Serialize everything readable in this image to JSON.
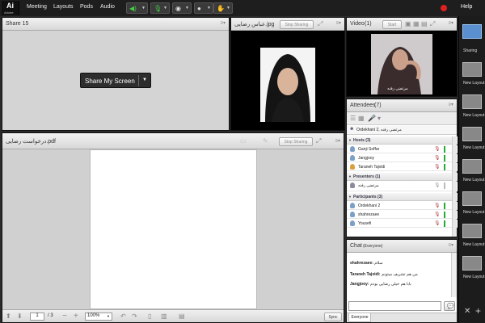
{
  "topbar": {
    "logo_mark": "Ai",
    "logo_text": "Adobe",
    "menus": [
      "Meeting",
      "Layouts",
      "Pods",
      "Audio"
    ],
    "help": "Help",
    "colors": {
      "bg": "#1e1e1e",
      "record": "#e02020"
    },
    "icons": [
      "microphone-icon",
      "webcam-icon",
      "user-icon",
      "raise-hand-icon"
    ]
  },
  "share_pod": {
    "title": "Share 15",
    "button_label": "Share My Screen"
  },
  "image_pod": {
    "title": "عباس رضایی.jpg",
    "stop_sharing": "Stop Sharing"
  },
  "video_pod": {
    "title": "Video",
    "count": "(1)",
    "start_label": "Start",
    "caption": "مرتضی رفنه"
  },
  "attendees_pod": {
    "title": "Attendees",
    "count": "(7)",
    "current_user": "Ordekhani 2, مرتضی رفنه",
    "hosts_header": "Hosts (3)",
    "hosts": [
      "Ganji Soffar",
      "Jangjooy",
      "Taraneh Tajvidi"
    ],
    "presenters_header": "Presenters (1)",
    "presenters": [
      "مرتضی رفنه"
    ],
    "participants_header": "Participants (3)",
    "participants": [
      "Ordekhani 2",
      "shahrezaee",
      "Yousefi"
    ]
  },
  "pdf_pod": {
    "title": "درخواست رضایی.pdf",
    "stop_sharing": "Stop Sharing",
    "page_current": "1",
    "page_total": "/ 3",
    "zoom": "100%",
    "sync_label": "Sync"
  },
  "chat_pod": {
    "title": "Chat",
    "audience": "(Everyone)",
    "messages": [
      {
        "from": "shahrezaee:",
        "text": "سلام"
      },
      {
        "from": "Taraneh Tajvidi:",
        "text": "من هم تشریف میتونم"
      },
      {
        "from": "Jangjooy:",
        "text": "بابا هم خیلی رضایی بودم"
      }
    ],
    "tab": "Everyone"
  },
  "layouts_panel": {
    "items": [
      "Sharing",
      "New Layout",
      "New Layout",
      "New Layout",
      "New Layout",
      "New Layout",
      "New Layout",
      "New Layout"
    ]
  }
}
